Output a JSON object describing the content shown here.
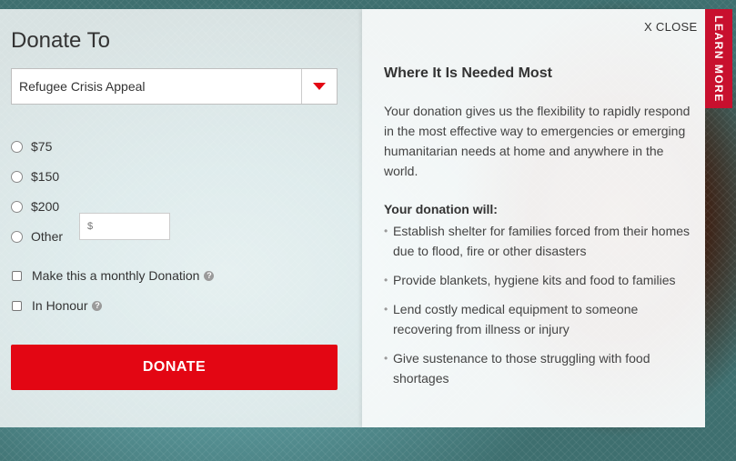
{
  "donate_form": {
    "title": "Donate To",
    "appeal_select": {
      "selected": "Refugee Crisis Appeal"
    },
    "amount_options": [
      {
        "label": "$75"
      },
      {
        "label": "$150"
      },
      {
        "label": "$200"
      },
      {
        "label": "Other"
      }
    ],
    "other_amount": {
      "placeholder": "$"
    },
    "monthly_label": "Make this a monthly Donation",
    "honour_label": "In Honour",
    "help_glyph": "?",
    "donate_button": "DONATE"
  },
  "info_panel": {
    "close_label": "X CLOSE",
    "title": "Where It Is Needed Most",
    "body": "Your donation gives us the flexibility to rapidly respond in the most effective way to emergencies or emerging humanitarian needs at home and anywhere in the world.",
    "will_heading": "Your donation will:",
    "bullet_glyph": "•",
    "benefits": [
      "Establish shelter for families forced from their homes due to flood, fire or other disasters",
      "Provide blankets, hygiene kits and food to families",
      "Lend costly medical equipment to someone recovering from illness or injury",
      "Give sustenance to those struggling with food shortages"
    ]
  },
  "learn_more_tab": {
    "label": "LEARN MORE"
  },
  "colors": {
    "accent_red": "#e30613",
    "tab_red": "#c8102e"
  },
  "icons": {
    "help": "question-circle-icon",
    "dropdown": "caret-down-icon"
  }
}
